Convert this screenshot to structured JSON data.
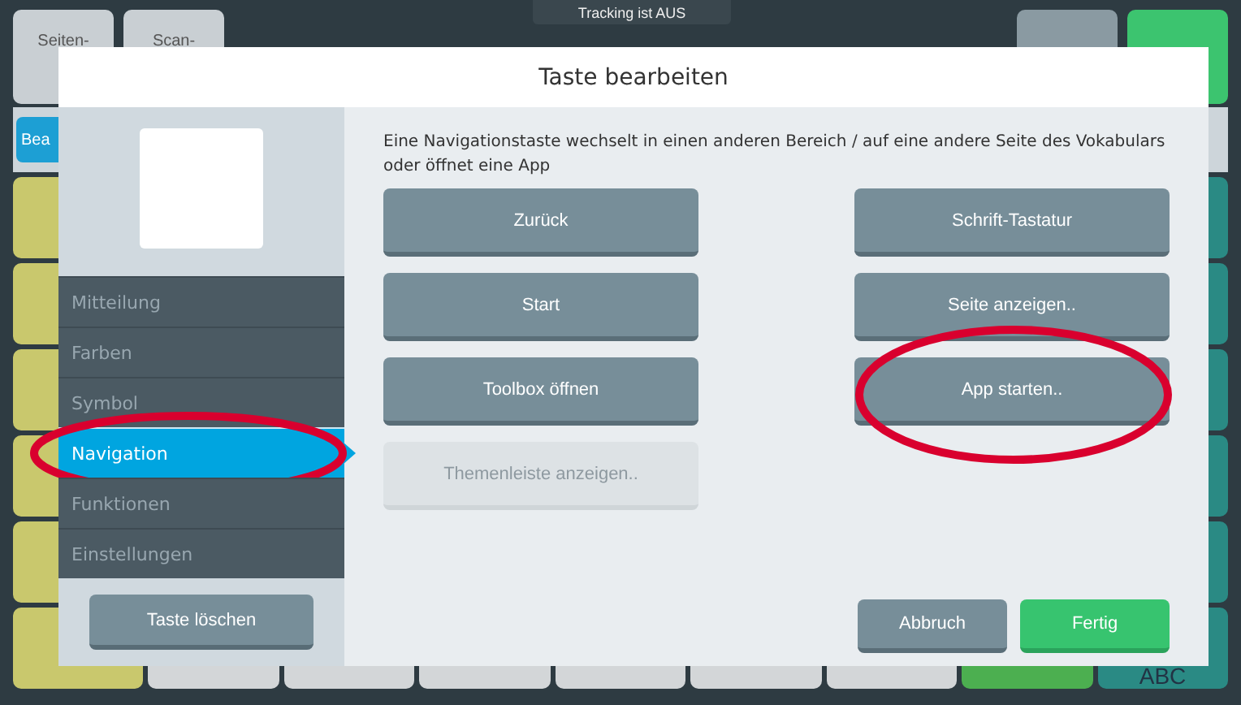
{
  "status": {
    "text": "Tracking ist AUS"
  },
  "top_keys": [
    {
      "label": "Seiten-"
    },
    {
      "label": "Scan-"
    }
  ],
  "toolbar_button": {
    "label": "Bea"
  },
  "keyboard_key": {
    "label": "ABC"
  },
  "dialog": {
    "title": "Taste bearbeiten",
    "description": "Eine Navigationstaste wechselt in einen anderen Bereich / auf eine andere Seite des Vokabulars oder öffnet eine App",
    "menu": [
      {
        "label": "Mitteilung",
        "selected": false,
        "highlighted": false
      },
      {
        "label": "Farben",
        "selected": false,
        "highlighted": false
      },
      {
        "label": "Symbol",
        "selected": false,
        "highlighted": false
      },
      {
        "label": "Navigation",
        "selected": true,
        "highlighted": true
      },
      {
        "label": "Funktionen",
        "selected": false,
        "highlighted": false
      },
      {
        "label": "Einstellungen",
        "selected": false,
        "highlighted": false
      }
    ],
    "options": [
      {
        "label": "Zurück",
        "disabled": false,
        "highlighted": false
      },
      {
        "label": "Schrift-Tastatur",
        "disabled": false,
        "highlighted": false
      },
      {
        "label": "Start",
        "disabled": false,
        "highlighted": false
      },
      {
        "label": "Seite anzeigen..",
        "disabled": false,
        "highlighted": false
      },
      {
        "label": "Toolbox öffnen",
        "disabled": false,
        "highlighted": false
      },
      {
        "label": "App starten..",
        "disabled": false,
        "highlighted": true
      },
      {
        "label": "Themenleiste anzeigen..",
        "disabled": true,
        "highlighted": false
      }
    ],
    "delete_button": "Taste löschen",
    "cancel_button": "Abbruch",
    "done_button": "Fertig"
  }
}
